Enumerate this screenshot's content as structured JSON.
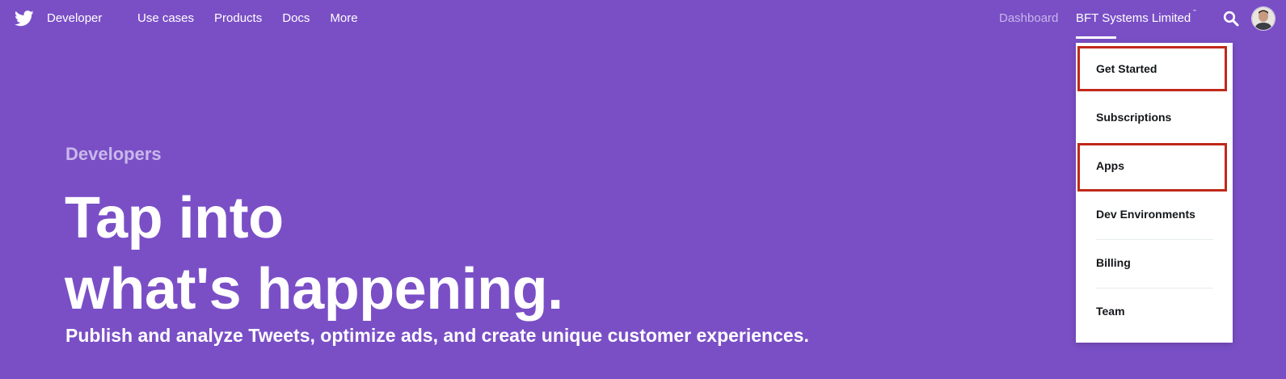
{
  "nav": {
    "brand": "Developer",
    "links": [
      {
        "label": "Use cases"
      },
      {
        "label": "Products"
      },
      {
        "label": "Docs"
      },
      {
        "label": "More"
      }
    ],
    "dashboard": "Dashboard",
    "account": "BFT Systems Limited",
    "account_chevron": "ˇ"
  },
  "hero": {
    "eyebrow": "Developers",
    "title_line1": "Tap into",
    "title_line2": "what's happening.",
    "subtitle": "Publish and analyze Tweets, optimize ads, and create unique customer experiences."
  },
  "dropdown": {
    "items": [
      {
        "label": "Get Started",
        "highlighted": true
      },
      {
        "label": "Subscriptions",
        "highlighted": false
      },
      {
        "label": "Apps",
        "highlighted": true
      },
      {
        "label": "Dev Environments",
        "highlighted": false
      },
      {
        "label": "Billing",
        "highlighted": false
      },
      {
        "label": "Team",
        "highlighted": false
      }
    ]
  },
  "colors": {
    "background": "#7a4fc6",
    "highlight": "#c0291b",
    "dashboard_text": "#c8b5ea"
  },
  "icons": {
    "logo": "twitter-bird-icon",
    "search": "search-icon"
  }
}
